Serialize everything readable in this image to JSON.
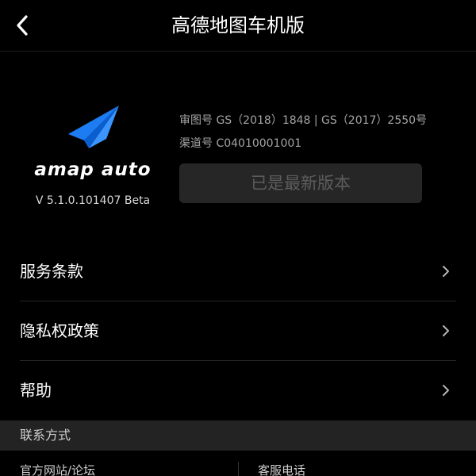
{
  "header": {
    "title": "高德地图车机版",
    "back_icon": "chevron-left-icon"
  },
  "about": {
    "logo_icon": "paper-plane-icon",
    "brand_name": "amap auto",
    "version": "V 5.1.0.101407 Beta",
    "map_approval": "审图号 GS（2018）1848 | GS（2017）2550号",
    "channel": "渠道号 C04010001001",
    "update_button_label": "已是最新版本"
  },
  "menu": {
    "items": [
      {
        "label": "服务条款"
      },
      {
        "label": "隐私权政策"
      },
      {
        "label": "帮助"
      }
    ]
  },
  "contact": {
    "section_title": "联系方式",
    "website_label": "官方网站/论坛",
    "phone_label": "客服电话"
  },
  "colors": {
    "background": "#000000",
    "logo_blue": "#1e7cf2",
    "button_bg": "#262626",
    "button_text": "#5c5c5c",
    "section_bg": "#232323"
  }
}
